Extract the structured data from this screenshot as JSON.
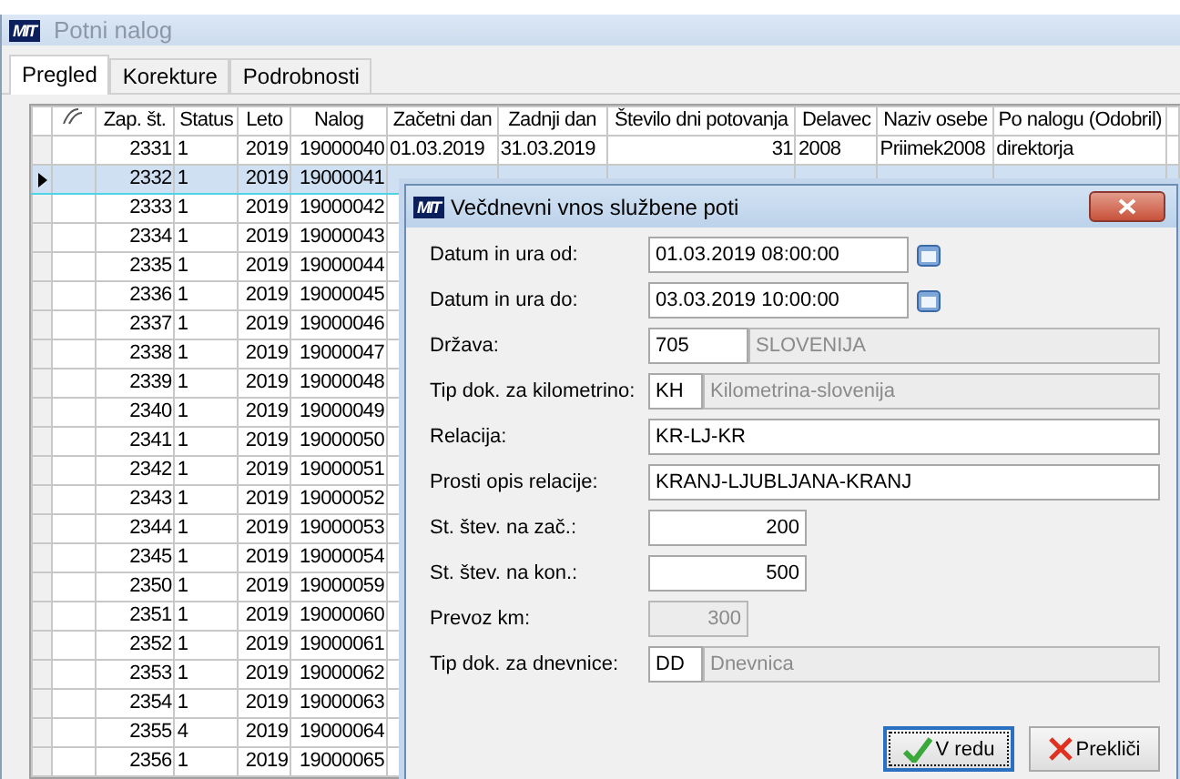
{
  "window": {
    "logo": "MIT",
    "title": "Potni nalog"
  },
  "tabs": [
    {
      "label": "Pregled",
      "selected": true
    },
    {
      "label": "Korekture",
      "selected": false
    },
    {
      "label": "Podrobnosti",
      "selected": false
    }
  ],
  "table": {
    "columns": [
      "",
      "",
      "Zap. št.",
      "Status",
      "Leto",
      "Nalog",
      "Začetni dan",
      "Zadnji dan",
      "Število dni potovanja",
      "Delavec",
      "Naziv osebe",
      "Po nalogu (Odobril)"
    ],
    "rows": [
      {
        "selected": false,
        "cells": [
          "",
          "",
          "2331",
          "1",
          "2019",
          "19000040",
          "01.03.2019",
          "31.03.2019",
          "31",
          "2008",
          "Priimek2008",
          "direktorja"
        ]
      },
      {
        "selected": true,
        "cells": [
          "",
          "",
          "2332",
          "1",
          "2019",
          "19000041"
        ]
      },
      {
        "selected": false,
        "cells": [
          "",
          "",
          "2333",
          "1",
          "2019",
          "19000042"
        ]
      },
      {
        "selected": false,
        "cells": [
          "",
          "",
          "2334",
          "1",
          "2019",
          "19000043"
        ]
      },
      {
        "selected": false,
        "cells": [
          "",
          "",
          "2335",
          "1",
          "2019",
          "19000044"
        ]
      },
      {
        "selected": false,
        "cells": [
          "",
          "",
          "2336",
          "1",
          "2019",
          "19000045"
        ]
      },
      {
        "selected": false,
        "cells": [
          "",
          "",
          "2337",
          "1",
          "2019",
          "19000046"
        ]
      },
      {
        "selected": false,
        "cells": [
          "",
          "",
          "2338",
          "1",
          "2019",
          "19000047"
        ]
      },
      {
        "selected": false,
        "cells": [
          "",
          "",
          "2339",
          "1",
          "2019",
          "19000048"
        ]
      },
      {
        "selected": false,
        "cells": [
          "",
          "",
          "2340",
          "1",
          "2019",
          "19000049"
        ]
      },
      {
        "selected": false,
        "cells": [
          "",
          "",
          "2341",
          "1",
          "2019",
          "19000050"
        ]
      },
      {
        "selected": false,
        "cells": [
          "",
          "",
          "2342",
          "1",
          "2019",
          "19000051"
        ]
      },
      {
        "selected": false,
        "cells": [
          "",
          "",
          "2343",
          "1",
          "2019",
          "19000052"
        ]
      },
      {
        "selected": false,
        "cells": [
          "",
          "",
          "2344",
          "1",
          "2019",
          "19000053"
        ]
      },
      {
        "selected": false,
        "cells": [
          "",
          "",
          "2345",
          "1",
          "2019",
          "19000054"
        ]
      },
      {
        "selected": false,
        "cells": [
          "",
          "",
          "2350",
          "1",
          "2019",
          "19000059"
        ]
      },
      {
        "selected": false,
        "cells": [
          "",
          "",
          "2351",
          "1",
          "2019",
          "19000060"
        ]
      },
      {
        "selected": false,
        "cells": [
          "",
          "",
          "2352",
          "1",
          "2019",
          "19000061"
        ]
      },
      {
        "selected": false,
        "cells": [
          "",
          "",
          "2353",
          "1",
          "2019",
          "19000062"
        ]
      },
      {
        "selected": false,
        "cells": [
          "",
          "",
          "2354",
          "1",
          "2019",
          "19000063"
        ]
      },
      {
        "selected": false,
        "cells": [
          "",
          "",
          "2355",
          "4",
          "2019",
          "19000064"
        ]
      },
      {
        "selected": false,
        "cells": [
          "",
          "",
          "2356",
          "1",
          "2019",
          "19000065"
        ]
      }
    ]
  },
  "dialog": {
    "logo": "MIT",
    "title": "Večdnevni vnos službene poti",
    "fields": [
      {
        "kind": "date",
        "label": "Datum in ura od:",
        "value": "01.03.2019 08:00:00"
      },
      {
        "kind": "date",
        "label": "Datum in ura do:",
        "value": "03.03.2019 10:00:00"
      },
      {
        "kind": "code",
        "label": "Država:",
        "value": "705",
        "name": "SLOVENIJA"
      },
      {
        "kind": "shortcode",
        "label": "Tip dok. za kilometrino:",
        "value": "KH",
        "name": "Kilometrina-slovenija"
      },
      {
        "kind": "text",
        "label": "Relacija:",
        "value": "KR-LJ-KR"
      },
      {
        "kind": "text",
        "label": "Prosti opis relacije:",
        "value": "KRANJ-LJUBLJANA-KRANJ"
      },
      {
        "kind": "number",
        "label": "St. štev. na zač.:",
        "value": "200"
      },
      {
        "kind": "number",
        "label": "St. štev. na kon.:",
        "value": "500"
      },
      {
        "kind": "readonly_number",
        "label": "Prevoz km:",
        "value": "300"
      },
      {
        "kind": "shortcode",
        "label": "Tip dok. za dnevnice:",
        "value": "DD",
        "name": "Dnevnica"
      }
    ],
    "buttons": [
      {
        "kind": "ok",
        "label": "V redu",
        "focused": true
      },
      {
        "kind": "cancel",
        "label": "Prekliči",
        "focused": false
      }
    ]
  }
}
